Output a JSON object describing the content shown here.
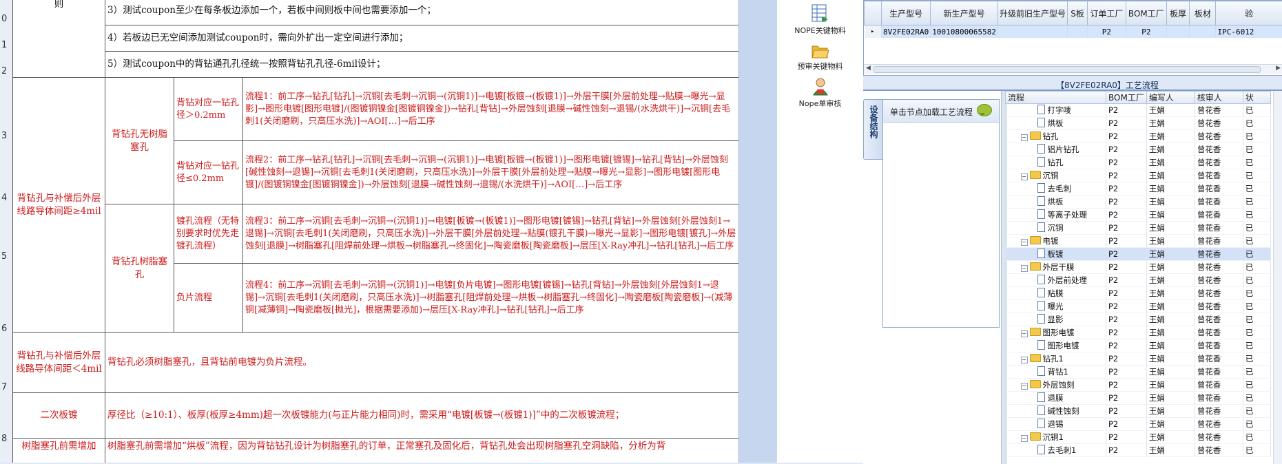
{
  "ruler": [
    "0",
    "1",
    "2",
    "3",
    "4",
    "5",
    "6",
    "7",
    "8"
  ],
  "doc": {
    "top_left_fragment": "则",
    "rule3": "3）测试coupon至少在每条板边添加一个，若板中间则板中间也需要添加一个；",
    "rule4": "4）若板边已无空间添加测试coupon时，需向外扩出一定空间进行添加；",
    "rule5": "5）测试coupon中的背钻通孔孔径统一按照背钻孔孔径-6mil设计；",
    "cond_ge": "背钻孔与补偿后外层线路导体间距≥4mil",
    "no_resin": "背钻孔无树脂塞孔",
    "resin": "背钻孔树脂塞孔",
    "dia_gt": "背钻对应一钻孔径＞0.2mm",
    "dia_le": "背钻对应一钻孔径≤0.2mm",
    "plating_flow": "镀孔流程（无特别要求时优先走镀孔流程）",
    "neg_flow": "负片流程",
    "flow1": "流程1：前工序→钻孔[钻孔]→沉铜[去毛刺→沉铜→(沉铜1)]→电镀[板镀→(板镀1)]→外层干膜[外层前处理→贴膜→曝光→显影]→图形电镀[图形电镀]/(图镀铜镍金[图镀铜镍金])→钻孔[背钻]→外层蚀刻[退膜→碱性蚀刻→退锡/(水洗烘干)]→沉铜[去毛刺1(关闭磨刷，只高压水洗)]→AOI[…]→后工序",
    "flow2": "流程2：前工序→钻孔[钻孔]→沉铜[去毛刺→沉铜→(沉铜1)]→电镀[板镀→(板镀1)]→图形电镀[镀锡]→钻孔[背钻]→外层蚀刻[碱性蚀刻→退锡]→沉铜[去毛刺1(关闭磨刷，只高压水洗)]→外层干膜[外层前处理→贴膜→曝光→显影]→图形电镀[图形电镀]/(图镀铜镍金[图镀铜镍金])→外层蚀刻[退膜→碱性蚀刻→退锡/(水洗烘干)]→AOI[…]→后工序",
    "flow3": "流程3：前工序→沉铜[去毛刺→沉铜→(沉铜1)]→电镀[板镀→(板镀1)]→图形电镀[镀锡]→钻孔[背钻]→外层蚀刻[外层蚀刻1→退锡]→沉铜[去毛刺1(关闭磨刷，只高压水洗)]→外层干膜[外层前处理→贴膜(镀孔干膜)→曝光→显影]→图形电镀[镀孔]→外层蚀刻[退膜]→树脂塞孔[阻焊前处理→烘板→树脂塞孔→终固化]→陶瓷磨板[陶瓷磨板]→层压[X-Ray冲孔]→钻孔[钻孔]→后工序",
    "flow4": "流程4：前工序→沉铜[去毛刺→沉铜→(沉铜1)]→电镀[负片电镀]→图形电镀[镀锡]→钻孔[背钻]→外层蚀刻[外层蚀刻1→退锡]→沉铜[去毛刺1(关闭磨刷，只高压水洗)]→树脂塞孔[阻焊前处理→烘板→树脂塞孔→终固化]→陶瓷磨板[陶瓷磨板]→(减薄铜[减薄铜]→陶瓷磨板[抛光]，根据需要添加)→层压[X-Ray冲孔]→钻孔[钻孔]→后工序",
    "cond_lt": "背钻孔与补偿后外层线路导体间距＜4mil",
    "must_resin": "背钻孔必须树脂塞孔，且背钻前电镀为负片流程。",
    "secondary": "二次板镀",
    "secondary_desc": "厚径比（≥10:1）、板厚(板厚≥4mm)超一次板镀能力(与正片能力相同)时，需采用“电镀[板镀→(板镀1)]”中的二次板镀流程；",
    "resin_add": "树脂塞孔前需增加",
    "resin_add_desc": "树脂塞孔前需增加“烘板”流程，因为背钻钻孔设计为树脂塞孔的订单，正常塞孔及固化后，背钻孔处会出现树脂塞孔空洞缺陷，分析为背"
  },
  "tools": [
    {
      "label": "NOPE关键物料",
      "icon": "spreadsheet-icon"
    },
    {
      "label": "预审关键物料",
      "icon": "folder-open-icon"
    },
    {
      "label": "Nope单审核",
      "icon": "user-approve-icon"
    }
  ],
  "grid": {
    "headers": [
      "生产型号",
      "新生产型号",
      "升级前旧生产型号",
      "S板",
      "订单工厂",
      "BOM工厂",
      "板厚",
      "板材",
      "验"
    ],
    "row": [
      "8V2FE02RA0",
      "10010800065582",
      "",
      "",
      "P2",
      "P2",
      "",
      "",
      "IPC-6012"
    ]
  },
  "flow": {
    "title": "【8V2FE02RA0】工艺流程",
    "vtab": "设备结构",
    "node_hint": "单击节点加载工艺流程",
    "tree_headers": [
      "流程",
      "BOM工厂",
      "编写人",
      "核审人",
      "状"
    ],
    "rows": [
      {
        "name": "打字唛",
        "level": 2,
        "type": "doc",
        "bom": "P2",
        "writer": "王娟",
        "reviewer": "曾花香",
        "status": "已"
      },
      {
        "name": "烘板",
        "level": 2,
        "type": "doc",
        "bom": "P2",
        "writer": "王娟",
        "reviewer": "曾花香",
        "status": "已"
      },
      {
        "name": "钻孔",
        "level": 1,
        "type": "folder",
        "bom": "P2",
        "writer": "王娟",
        "reviewer": "曾花香",
        "status": "已"
      },
      {
        "name": "铝片钻孔",
        "level": 2,
        "type": "doc",
        "bom": "P2",
        "writer": "王娟",
        "reviewer": "曾花香",
        "status": "已"
      },
      {
        "name": "钻孔",
        "level": 2,
        "type": "doc",
        "bom": "P2",
        "writer": "王娟",
        "reviewer": "曾花香",
        "status": "已"
      },
      {
        "name": "沉铜",
        "level": 1,
        "type": "folder",
        "bom": "P2",
        "writer": "王娟",
        "reviewer": "曾花香",
        "status": "已"
      },
      {
        "name": "去毛刺",
        "level": 2,
        "type": "doc",
        "bom": "P2",
        "writer": "王娟",
        "reviewer": "曾花香",
        "status": "已"
      },
      {
        "name": "烘板",
        "level": 2,
        "type": "doc",
        "bom": "P2",
        "writer": "王娟",
        "reviewer": "曾花香",
        "status": "已"
      },
      {
        "name": "等离子处理",
        "level": 2,
        "type": "doc",
        "bom": "P2",
        "writer": "王娟",
        "reviewer": "曾花香",
        "status": "已"
      },
      {
        "name": "沉铜",
        "level": 2,
        "type": "doc",
        "bom": "P2",
        "writer": "王娟",
        "reviewer": "曾花香",
        "status": "已"
      },
      {
        "name": "电镀",
        "level": 1,
        "type": "folder",
        "bom": "P2",
        "writer": "王娟",
        "reviewer": "曾花香",
        "status": "已"
      },
      {
        "name": "板镀",
        "level": 2,
        "type": "doc",
        "bom": "P2",
        "writer": "王娟",
        "reviewer": "曾花香",
        "status": "已",
        "selected": true
      },
      {
        "name": "外层干膜",
        "level": 1,
        "type": "folder",
        "bom": "P2",
        "writer": "王娟",
        "reviewer": "曾花香",
        "status": "已"
      },
      {
        "name": "外层前处理",
        "level": 2,
        "type": "doc",
        "bom": "P2",
        "writer": "王娟",
        "reviewer": "曾花香",
        "status": "已"
      },
      {
        "name": "贴膜",
        "level": 2,
        "type": "doc",
        "bom": "P2",
        "writer": "王娟",
        "reviewer": "曾花香",
        "status": "已"
      },
      {
        "name": "曝光",
        "level": 2,
        "type": "doc",
        "bom": "P2",
        "writer": "王娟",
        "reviewer": "曾花香",
        "status": "已"
      },
      {
        "name": "显影",
        "level": 2,
        "type": "doc",
        "bom": "P2",
        "writer": "王娟",
        "reviewer": "曾花香",
        "status": "已"
      },
      {
        "name": "图形电镀",
        "level": 1,
        "type": "folder",
        "bom": "P2",
        "writer": "王娟",
        "reviewer": "曾花香",
        "status": "已"
      },
      {
        "name": "图形电镀",
        "level": 2,
        "type": "doc",
        "bom": "P2",
        "writer": "王娟",
        "reviewer": "曾花香",
        "status": "已"
      },
      {
        "name": "钻孔1",
        "level": 1,
        "type": "folder",
        "bom": "P2",
        "writer": "王娟",
        "reviewer": "曾花香",
        "status": "已"
      },
      {
        "name": "背钻1",
        "level": 2,
        "type": "doc",
        "bom": "P2",
        "writer": "王娟",
        "reviewer": "曾花香",
        "status": "已"
      },
      {
        "name": "外层蚀刻",
        "level": 1,
        "type": "folder",
        "bom": "P2",
        "writer": "王娟",
        "reviewer": "曾花香",
        "status": "已"
      },
      {
        "name": "退膜",
        "level": 2,
        "type": "doc",
        "bom": "P2",
        "writer": "王娟",
        "reviewer": "曾花香",
        "status": "已"
      },
      {
        "name": "碱性蚀刻",
        "level": 2,
        "type": "doc",
        "bom": "P2",
        "writer": "王娟",
        "reviewer": "曾花香",
        "status": "已"
      },
      {
        "name": "退锡",
        "level": 2,
        "type": "doc",
        "bom": "P2",
        "writer": "王娟",
        "reviewer": "曾花香",
        "status": "已"
      },
      {
        "name": "沉铜1",
        "level": 1,
        "type": "folder",
        "bom": "P2",
        "writer": "王娟",
        "reviewer": "曾花香",
        "status": "已"
      },
      {
        "name": "去毛刺1",
        "level": 2,
        "type": "doc",
        "bom": "P2",
        "writer": "王娟",
        "reviewer": "曾花香",
        "status": "已"
      }
    ]
  }
}
